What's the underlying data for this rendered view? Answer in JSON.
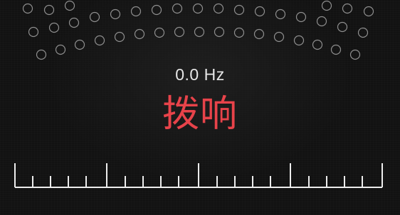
{
  "tuner": {
    "frequency": "0.0 Hz",
    "status": "拨响",
    "status_color": "#e8434a"
  },
  "scale": {
    "major_every": 5,
    "tick_count": 21
  }
}
